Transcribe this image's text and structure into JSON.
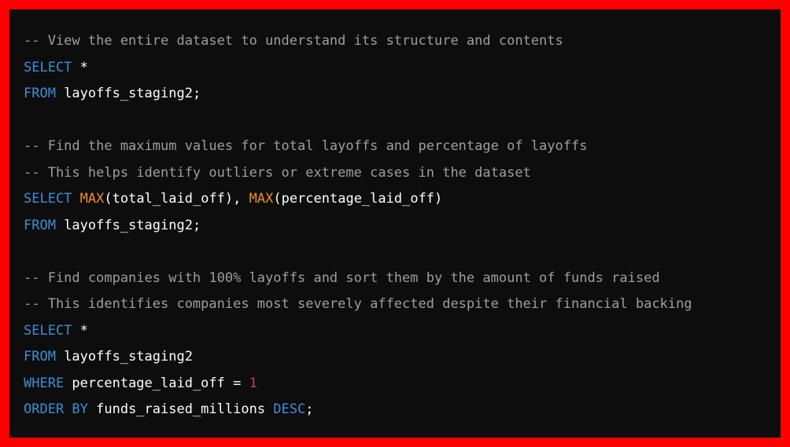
{
  "colors": {
    "border": "#ff0000",
    "background": "#0d0d0d",
    "comment": "#9e9e9e",
    "keyword": "#3d8fd6",
    "function": "#f28c28",
    "number": "#d0315f",
    "text": "#ffffff"
  },
  "code": {
    "l1": {
      "comment": "-- View the entire dataset to understand its structure and contents"
    },
    "l2": {
      "select": "SELECT",
      "star": " *"
    },
    "l3": {
      "from": "FROM",
      "table": " layoffs_staging2;"
    },
    "l5": {
      "comment": "-- Find the maximum values for total layoffs and percentage of layoffs"
    },
    "l6": {
      "comment": "-- This helps identify outliers or extreme cases in the dataset"
    },
    "l7": {
      "select": "SELECT",
      "max1": "MAX",
      "arg1": "(total_laid_off), ",
      "max2": "MAX",
      "arg2": "(percentage_laid_off)"
    },
    "l8": {
      "from": "FROM",
      "table": " layoffs_staging2;"
    },
    "l10": {
      "comment": "-- Find companies with 100% layoffs and sort them by the amount of funds raised"
    },
    "l11": {
      "comment": "-- This identifies companies most severely affected despite their financial backing"
    },
    "l12": {
      "select": "SELECT",
      "star": " *"
    },
    "l13": {
      "from": "FROM",
      "table": " layoffs_staging2"
    },
    "l14": {
      "where": "WHERE",
      "cond": " percentage_laid_off = ",
      "value": "1"
    },
    "l15": {
      "orderby": "ORDER BY",
      "col": " funds_raised_millions ",
      "desc": "DESC",
      "end": ";"
    }
  }
}
